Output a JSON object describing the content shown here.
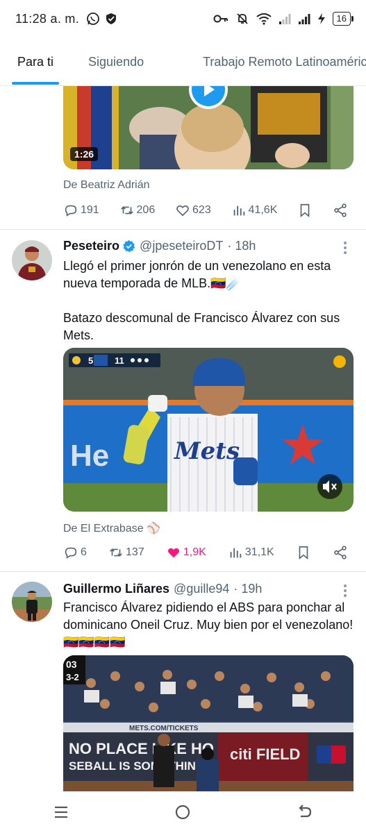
{
  "status_bar": {
    "time": "11:28 a. m.",
    "battery": "16"
  },
  "tabs": [
    {
      "label": "Para ti",
      "active": true
    },
    {
      "label": "Siguiendo",
      "active": false
    },
    {
      "label": "Trabajo Remoto Latinoamérica",
      "active": false
    }
  ],
  "tweet_top": {
    "video_duration": "1:26",
    "source_prefix": "De",
    "source_name": "Beatriz Adrián",
    "replies": "191",
    "retweets": "206",
    "likes": "623",
    "views": "41,6K"
  },
  "tweet_1": {
    "name": "Peseteiro",
    "handle": "@jpeseteiroDT",
    "time": "· 18h",
    "text_line1": "Llegó el primer jonrón de un venezolano en esta nueva temporada de MLB.🇻🇪☄️",
    "text_line2": "Batazo descomunal de Francisco Álvarez con sus Mets.",
    "scorebug": {
      "away": "5",
      "home": "11"
    },
    "source_prefix": "De",
    "source_name": "El Extrabase ⚾",
    "replies": "6",
    "retweets": "137",
    "likes": "1,9K",
    "views": "31,1K",
    "liked": true,
    "colors": {
      "like": "#f91880"
    }
  },
  "tweet_2": {
    "name": "Guillermo Liñares",
    "handle": "@guille94",
    "time": "· 19h",
    "text": "Francisco Álvarez pidiendo el ABS para ponchar al dominicano Oneil Cruz. Muy bien por el venezolano! 🇻🇪🇻🇪🇻🇪🇻🇪",
    "banner_text_1": "NO PLACE LIKE HO",
    "banner_text_2": "SEBALL IS SOMETHIN",
    "banner_right": "citi FIELD",
    "url_text": "METS.COM/TICKETS",
    "scoreboard": "03\n3-2"
  },
  "colors": {
    "accent": "#1d9bf0",
    "secondary_text": "#536471",
    "primary_text": "#0f1419"
  }
}
